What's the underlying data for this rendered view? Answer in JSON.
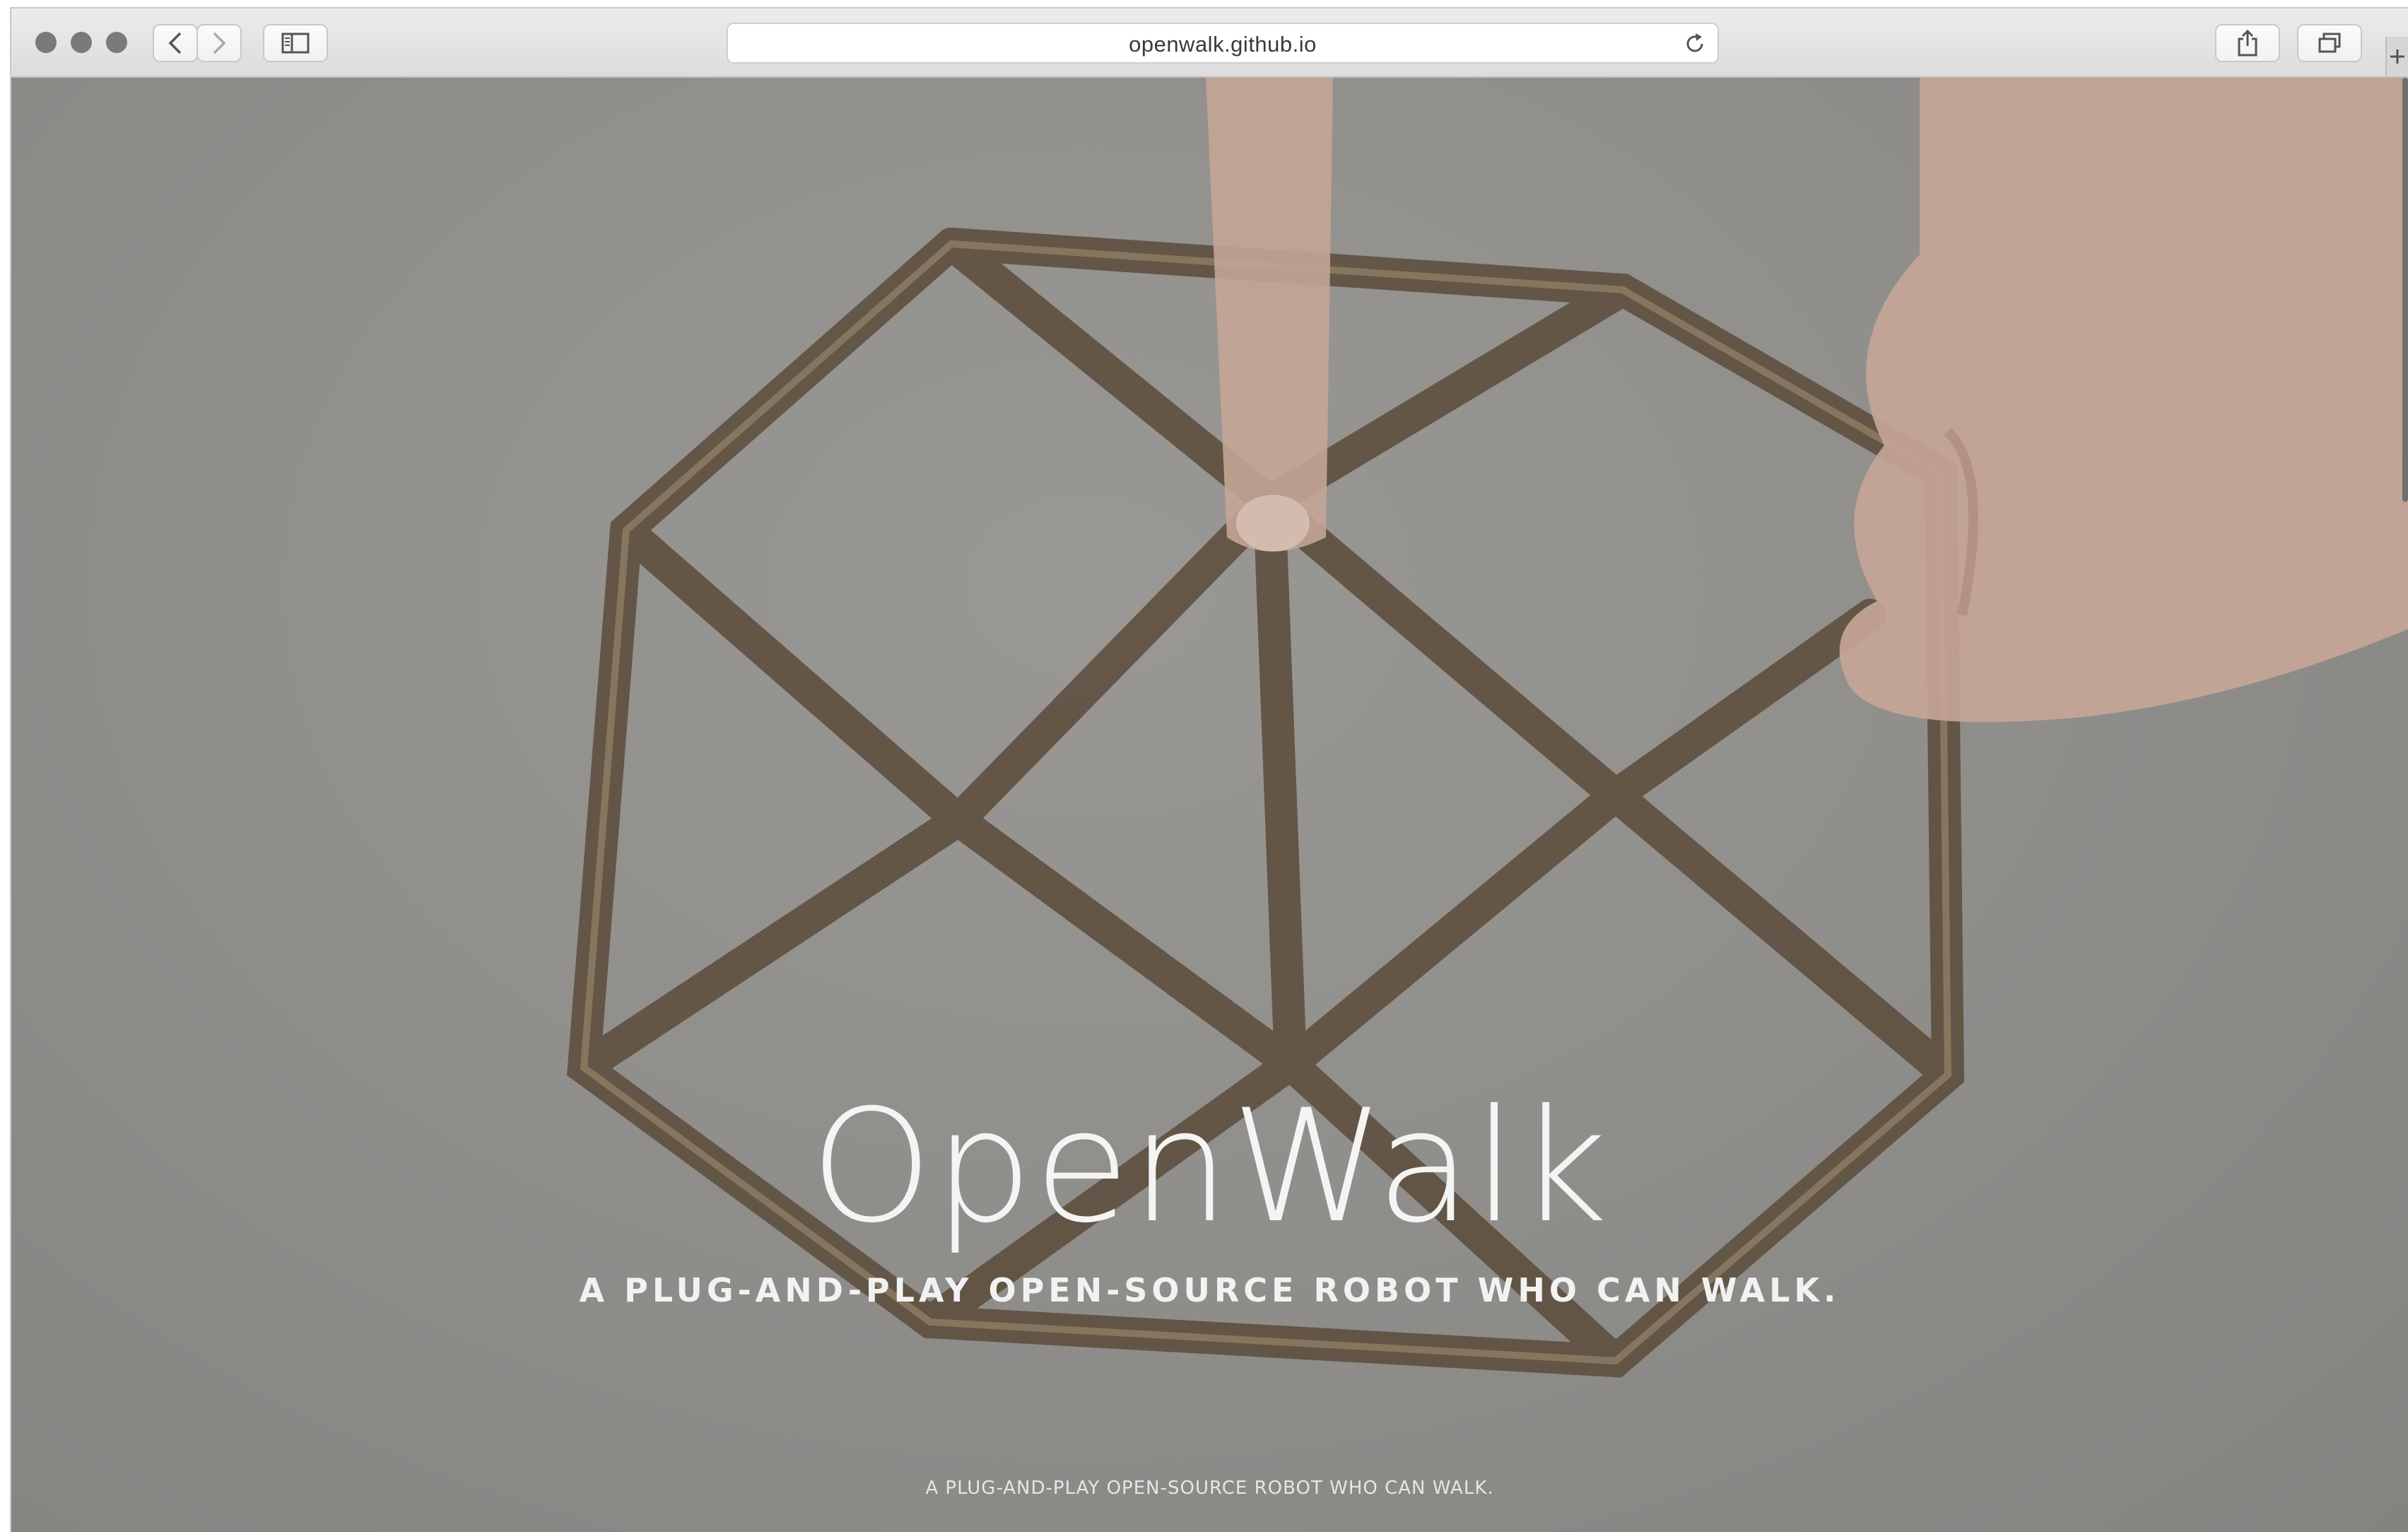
{
  "browser": {
    "url": "openwalk.github.io",
    "icons": {
      "back": "chevron-left-icon",
      "forward": "chevron-right-icon",
      "sidebar": "sidebar-icon",
      "reload": "reload-icon",
      "share": "share-icon",
      "tabs": "tabs-icon",
      "new_tab": "plus-icon"
    }
  },
  "hero": {
    "title": "OpenWalk",
    "subtitle": "A PLUG-AND-PLAY OPEN-SOURCE ROBOT WHO CAN WALK.",
    "footer_text": "A PLUG-AND-PLAY OPEN-SOURCE ROBOT WHO CAN WALK."
  },
  "colors": {
    "overlay": "#8e8c89",
    "strut": "#6a5a46",
    "skin": "#c9a898"
  }
}
